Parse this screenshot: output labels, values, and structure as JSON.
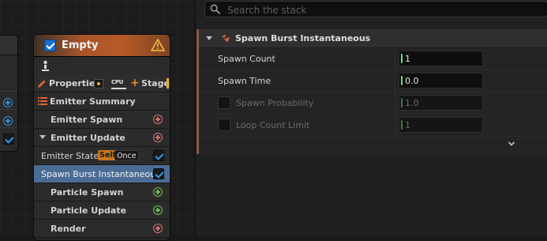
{
  "node": {
    "title": "Empty",
    "properties_label": "Properties",
    "stage_label": "Stage",
    "cpu_label": "CPU",
    "rows": [
      {
        "label": "Emitter Summary"
      },
      {
        "label": "Emitter Spawn"
      },
      {
        "label": "Emitter Update"
      },
      {
        "label": "Emitter State",
        "tag_self": "Self",
        "tag_once": "Once"
      },
      {
        "label": "Spawn Burst Instantaneous"
      },
      {
        "label": "Particle Spawn"
      },
      {
        "label": "Particle Update"
      },
      {
        "label": "Render"
      }
    ]
  },
  "stack": {
    "search_placeholder": "Search the stack",
    "section_title": "Spawn Burst Instantaneous",
    "params": [
      {
        "label": "Spawn Count",
        "value": "1"
      },
      {
        "label": "Spawn Time",
        "value": "0.0"
      },
      {
        "label": "Spawn Probability",
        "value": "1.0"
      },
      {
        "label": "Loop Count Limit",
        "value": "1"
      }
    ]
  },
  "colors": {
    "header_accent": "#b85a26",
    "selected_row": "#4b6d95",
    "check_blue": "#2f9bf0",
    "value_marker": "#5ee86a"
  }
}
